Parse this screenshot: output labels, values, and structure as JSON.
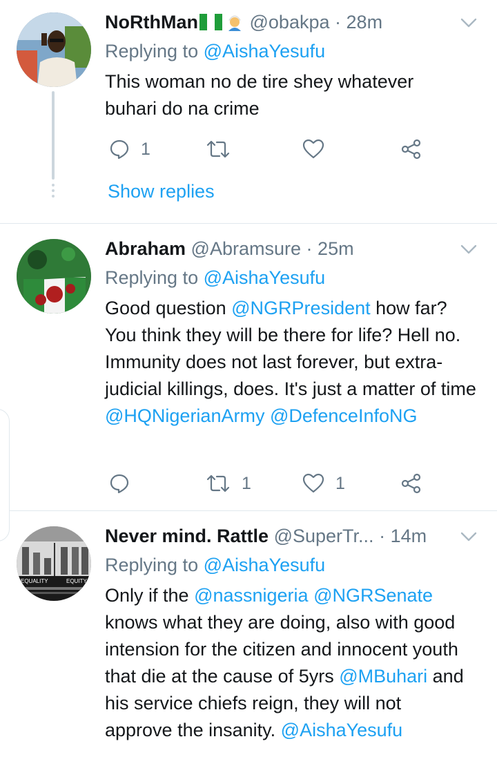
{
  "colors": {
    "link": "#1da1f2",
    "muted": "#657786",
    "text": "#14171a",
    "divider": "#e1e8ed"
  },
  "tweets": [
    {
      "name": "NoRthMan",
      "handle": "@obakpa",
      "time": "28m",
      "replying_prefix": "Replying to",
      "replying_to": "@AishaYesufu",
      "text": "This woman no de tire shey whatever buhari do na crime",
      "replies": "1",
      "retweets": "",
      "likes": "",
      "show_replies": "Show replies",
      "icons": [
        "nigeria-flag-icon",
        "person-turban-emoji-icon"
      ]
    },
    {
      "name": "Abraham",
      "handle": "@Abramsure",
      "time": "25m",
      "replying_prefix": "Replying to",
      "replying_to": "@AishaYesufu",
      "text_parts": [
        "Good question ",
        "@NGRPresident",
        " how far? You think they will be there for life? Hell no. Immunity does not last forever, but extra-judicial killings, does. It's just a matter of time ",
        "@HQNigerianArmy",
        " ",
        "@DefenceInfoNG"
      ],
      "replies": "",
      "retweets": "1",
      "likes": "1"
    },
    {
      "name": "Never mind. Rattle",
      "handle": "@SuperTr...",
      "time": "14m",
      "replying_prefix": "Replying to",
      "replying_to": "@AishaYesufu",
      "text_parts": [
        "Only if the ",
        "@nassnigeria",
        " ",
        "@NGRSenate",
        " knows what they are doing, also with good intension for the citizen and innocent youth that die at the cause of 5yrs ",
        "@MBuhari",
        " and his service chiefs reign, they will not approve the insanity. ",
        "@AishaYesufu"
      ],
      "avatar_text": {
        "left": "EQUALITY",
        "right": "EQUITY"
      }
    }
  ]
}
